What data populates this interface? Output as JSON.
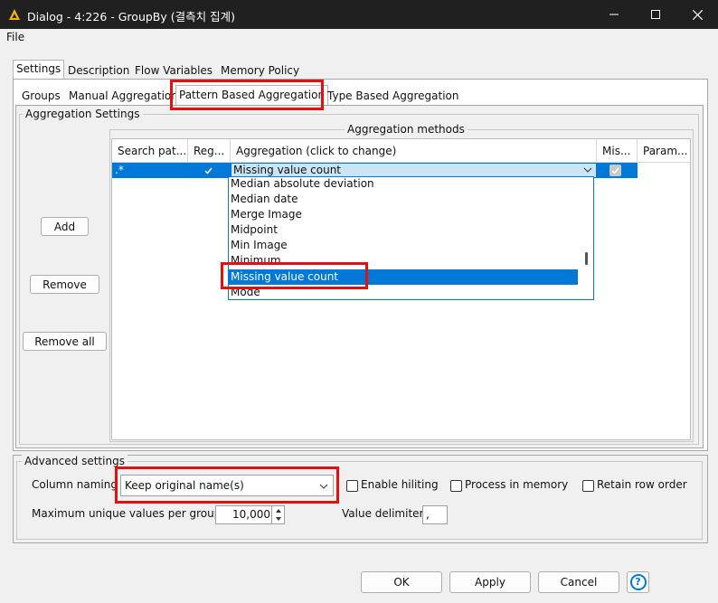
{
  "window": {
    "title": "Dialog - 4:226 - GroupBy (결측치 집계)"
  },
  "menu": {
    "file": "File"
  },
  "tabs": [
    "Settings",
    "Description",
    "Flow Variables",
    "Memory Policy"
  ],
  "subtabs": [
    "Groups",
    "Manual Aggregation",
    "Pattern Based Aggregation",
    "Type Based Aggregation"
  ],
  "aggregation_settings": {
    "legend": "Aggregation Settings",
    "add": "Add",
    "remove": "Remove",
    "remove_all": "Remove all",
    "methods_legend": "Aggregation methods",
    "columns": [
      "Search pat...",
      "Reg...",
      "Aggregation (click to change)",
      "Mis...",
      "Param..."
    ],
    "row": {
      "pattern": ".*",
      "regex_checked": true,
      "aggregation": "Missing value count",
      "missing_checked": true,
      "param": ""
    },
    "dropdown_items": [
      "Median absolute deviation",
      "Median date",
      "Merge Image",
      "Midpoint",
      "Min Image",
      "Minimum",
      "Missing value count",
      "Mode"
    ],
    "selected_item": "Missing value count"
  },
  "advanced": {
    "legend": "Advanced settings",
    "column_naming_label": "Column naming",
    "column_naming_value": "Keep original name(s)",
    "enable_hiliting": "Enable hiliting",
    "process_in_memory": "Process in memory",
    "retain_row_order": "Retain row order",
    "max_unique_label": "Maximum unique values per group",
    "max_unique_value": "10,000",
    "value_delimiter_label": "Value delimiter",
    "value_delimiter_value": ","
  },
  "footer": {
    "ok": "OK",
    "apply": "Apply",
    "cancel": "Cancel",
    "help": "?"
  },
  "colors": {
    "accent": "#0078d7",
    "highlight": "#e31010",
    "titlebar": "#202020"
  }
}
